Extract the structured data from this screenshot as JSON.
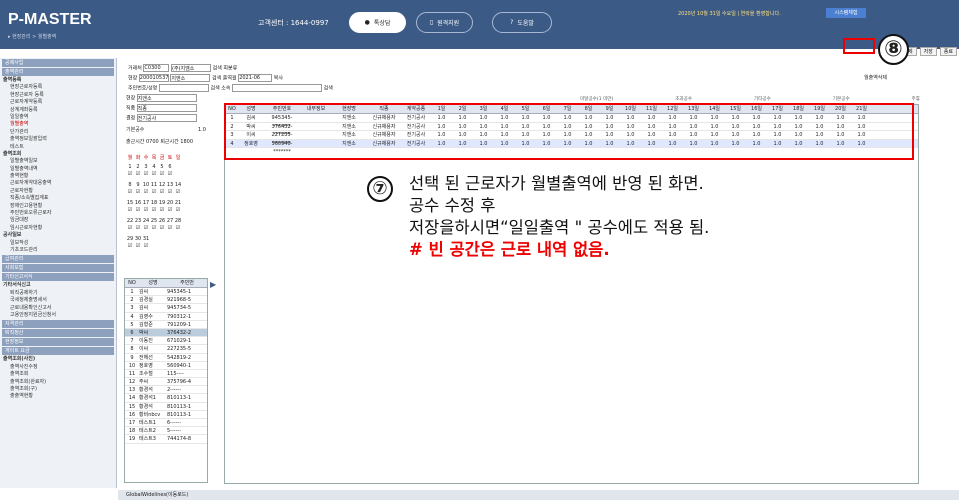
{
  "header": {
    "brand": "P-MASTER",
    "breadcrumb": "▸ 현장관리 > 월별출역",
    "tel": "고객센터 : 1644-0997",
    "buttons": [
      "톡상담",
      "원격지원",
      "도움말"
    ],
    "date_text": "2020년 10월 31일 수요일 | 연락을 환영합니다.",
    "sys_button": "시스템체험",
    "actions": [
      "조회",
      "삭제",
      "저장",
      "종료"
    ]
  },
  "sidebar": {
    "sections": [
      {
        "title": "공제사업",
        "items": []
      },
      {
        "title": "출역관리",
        "items": [
          {
            "label": "출역등록",
            "group": true
          },
          {
            "label": "현장근로자등록"
          },
          {
            "label": "현장근로자 등록"
          },
          {
            "label": "근로자계약등록"
          },
          {
            "label": "상계계좌등록"
          },
          {
            "label": "일일출역"
          },
          {
            "label": "월별출역",
            "active": true
          },
          {
            "label": "단가관리"
          },
          {
            "label": "출역정보일괄입력"
          },
          {
            "label": "테스트"
          },
          {
            "label": "출역조회",
            "group": true
          },
          {
            "label": "일별출역일보"
          },
          {
            "label": "일별출역내역"
          },
          {
            "label": "출역현황"
          },
          {
            "label": "근로자계약대응출역"
          },
          {
            "label": "근로자현황"
          },
          {
            "label": "직종/소속별집계표"
          },
          {
            "label": "장애인고용현황"
          },
          {
            "label": "주민번호오류근로자"
          },
          {
            "label": "임금대장"
          },
          {
            "label": "임시근로자현황"
          },
          {
            "label": "공사일보",
            "group": true
          },
          {
            "label": "일보작성"
          },
          {
            "label": "기초코드관리"
          }
        ]
      },
      {
        "title": "급여관리",
        "items": []
      },
      {
        "title": "사회보험",
        "items": []
      },
      {
        "title": "기타신고서식",
        "items": [
          {
            "label": "기타서식신고",
            "group": true
          },
          {
            "label": "퇴직공제하기"
          },
          {
            "label": "국세청제출명세서"
          },
          {
            "label": "근로내용확인신고서"
          },
          {
            "label": "고용안정지원금신청서"
          }
        ]
      },
      {
        "title": "자격관리",
        "items": []
      },
      {
        "title": "퇴직정산",
        "items": []
      },
      {
        "title": "현장정보",
        "items": []
      },
      {
        "title": "게이트 요금",
        "items": [
          {
            "label": "출역조회(사진)",
            "group": true
          },
          {
            "label": "출역사진수정"
          },
          {
            "label": "출역조회"
          },
          {
            "label": "출역조회(완료자)"
          },
          {
            "label": "출역조회(구)"
          },
          {
            "label": "출출역현황"
          }
        ]
      }
    ]
  },
  "left_panel": {
    "site_label": "현장",
    "site_value": "지앤소",
    "job_label": "직종",
    "job_value": "직종",
    "pay_label": "결정",
    "pay_value": "전기공사",
    "base_label": "기본공수",
    "base_value": "1.0",
    "time_label": "출근시간",
    "time_value": "0700 퇴근시간 1800",
    "weekdays": [
      "월",
      "화",
      "수",
      "목",
      "금",
      "토",
      "일"
    ],
    "cal_rows": [
      [
        "1",
        "2",
        "3",
        "4",
        "5",
        "6"
      ],
      [
        "8",
        "9",
        "10",
        "11",
        "12",
        "13",
        "14"
      ],
      [
        "15",
        "16",
        "17",
        "18",
        "19",
        "20",
        "21"
      ],
      [
        "22",
        "23",
        "24",
        "25",
        "26",
        "27",
        "28"
      ],
      [
        "29",
        "30",
        "31"
      ]
    ]
  },
  "filters": {
    "row1": [
      "거래처",
      "C0300",
      "(주)지엠소",
      "검색",
      "회분류"
    ],
    "row2": [
      "현장",
      "200010537",
      "지앤소",
      "검색",
      "출역월",
      "2021-06",
      "복사"
    ],
    "row3": [
      "주민번호/성명",
      "검색",
      "소속",
      "검색"
    ],
    "row_action": "월출역삭제"
  },
  "legend_labels": [
    "미달공수(1 미만)",
    "초과공수",
    "기타공수",
    "기본공수",
    "주휴"
  ],
  "worker_list": {
    "headers": [
      "NO",
      "성명",
      "주민번"
    ],
    "rows": [
      [
        "1",
        "김씨",
        "945345-1"
      ],
      [
        "2",
        "김경실",
        "921968-5"
      ],
      [
        "3",
        "김씨",
        "945734-5"
      ],
      [
        "4",
        "김영수",
        "790312-1"
      ],
      [
        "5",
        "김형준",
        "791209-1"
      ],
      [
        "6",
        "박씨",
        "376432-2"
      ],
      [
        "7",
        "이동진",
        "671029-1"
      ],
      [
        "8",
        "이씨",
        "227235-5"
      ],
      [
        "9",
        "전해선",
        "542819-2"
      ],
      [
        "10",
        "정호영",
        "560940-1"
      ],
      [
        "11",
        "조수철",
        "115----"
      ],
      [
        "12",
        "주씨",
        "375796-4"
      ],
      [
        "13",
        "황경석",
        "2------"
      ],
      [
        "14",
        "황경석1",
        "810113-1"
      ],
      [
        "15",
        "황경석",
        "810113-1"
      ],
      [
        "16",
        "황비nbcv",
        "810113-1"
      ],
      [
        "17",
        "테스트1",
        "6------"
      ],
      [
        "18",
        "테스트2",
        "5------"
      ],
      [
        "19",
        "테스트3",
        "744174-8"
      ]
    ]
  },
  "grid": {
    "headers": [
      "NO",
      "성명",
      "주민번호",
      "내부정보",
      "현장명",
      "직종",
      "계약공종",
      "1일",
      "2일",
      "3일",
      "4일",
      "5일",
      "6일",
      "7일",
      "8일",
      "9일",
      "10일",
      "11일",
      "12일",
      "13일",
      "14일",
      "15일",
      "16일",
      "17일",
      "18일",
      "19일",
      "20일",
      "21일"
    ],
    "rows": [
      [
        "1",
        "김씨",
        "945345-*******",
        "",
        "지앤소",
        "신규채용자",
        "전기공사",
        "1.0",
        "1.0",
        "1.0",
        "1.0",
        "1.0",
        "1.0",
        "1.0",
        "1.0",
        "1.0",
        "1.0",
        "1.0",
        "1.0",
        "1.0",
        "1.0",
        "1.0",
        "1.0",
        "1.0",
        "1.0",
        "1.0",
        "1.0",
        "1.0"
      ],
      [
        "2",
        "박씨",
        "376432-*******",
        "",
        "지앤소",
        "신규채용자",
        "전기공사",
        "1.0",
        "1.0",
        "1.0",
        "1.0",
        "1.0",
        "1.0",
        "1.0",
        "1.0",
        "1.0",
        "1.0",
        "1.0",
        "1.0",
        "1.0",
        "1.0",
        "1.0",
        "1.0",
        "1.0",
        "1.0",
        "1.0",
        "1.0",
        "1.0"
      ],
      [
        "3",
        "이씨",
        "227235-*******",
        "",
        "지앤소",
        "신규채용자",
        "전기공사",
        "1.0",
        "1.0",
        "1.0",
        "1.0",
        "1.0",
        "1.0",
        "1.0",
        "1.0",
        "1.0",
        "1.0",
        "1.0",
        "1.0",
        "1.0",
        "1.0",
        "1.0",
        "1.0",
        "1.0",
        "1.0",
        "1.0",
        "1.0",
        "1.0"
      ],
      [
        "4",
        "정호영",
        "560940-*******",
        "",
        "지앤소",
        "신규채용자",
        "전기공사",
        "1.0",
        "1.0",
        "1.0",
        "1.0",
        "1.0",
        "1.0",
        "1.0",
        "1.0",
        "1.0",
        "1.0",
        "1.0",
        "1.0",
        "1.0",
        "1.0",
        "1.0",
        "1.0",
        "1.0",
        "1.0",
        "1.0",
        "1.0",
        "1.0"
      ]
    ]
  },
  "callout": {
    "step7": "⑦",
    "lines": [
      "선택 된 근로자가 월별출역에 반영 된 화면.",
      "공수 수정 후",
      "저장을하시면“일일출역 \" 공수에도 적용 됨."
    ],
    "note": "# 빈 공간은 근로 내역 없음."
  },
  "step8": "⑧",
  "status": "GlobalWidelines(이동로드)",
  "colors": {
    "header": "#3c5a86",
    "red": "#e00000",
    "highlight": "#dfe8ff"
  }
}
